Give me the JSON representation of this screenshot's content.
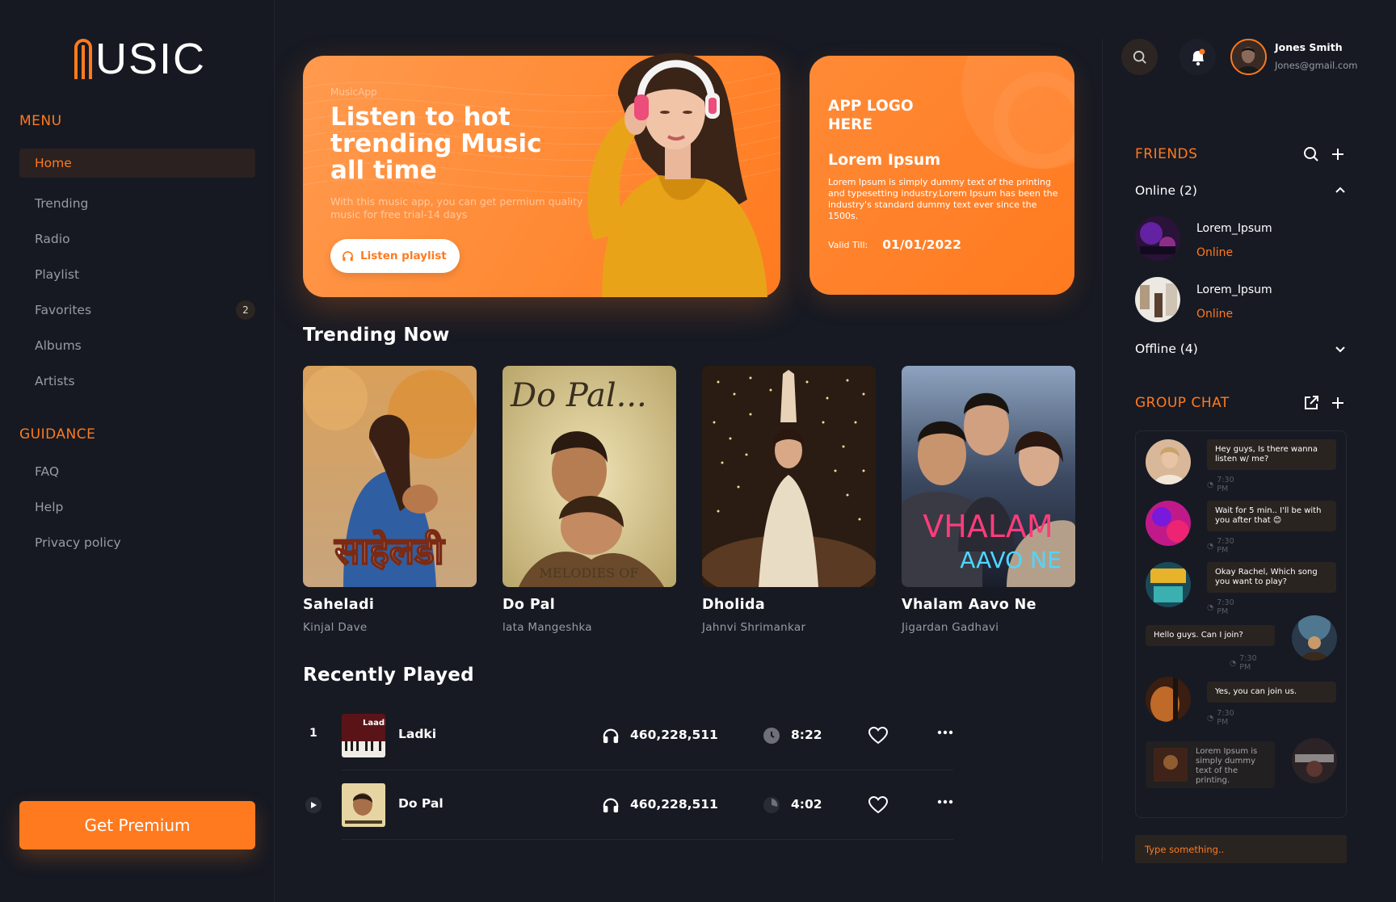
{
  "app": {
    "logo": "USIC"
  },
  "sidebar": {
    "menu_title": "MENU",
    "menu": [
      {
        "label": "Home",
        "active": true
      },
      {
        "label": "Trending"
      },
      {
        "label": "Radio"
      },
      {
        "label": "Playlist"
      },
      {
        "label": "Favorites",
        "badge": "2"
      },
      {
        "label": "Albums"
      },
      {
        "label": "Artists"
      }
    ],
    "guidance_title": "GUIDANCE",
    "guidance": [
      {
        "label": "FAQ"
      },
      {
        "label": "Help"
      },
      {
        "label": "Privacy policy"
      }
    ],
    "premium_button": "Get Premium"
  },
  "hero": {
    "eyebrow": "MusicApp",
    "title": "Listen to hot trending Music all time",
    "description": "With this music app, you can get permium quality music for free trial-14 days",
    "button": "Listen playlist"
  },
  "promo": {
    "logo": "APP LOGO HERE",
    "title": "Lorem Ipsum",
    "text": "Lorem Ipsum is simply dummy text of the printing and typesetting industry.Lorem Ipsum has been the industry's standard dummy text ever since the 1500s.",
    "valid_label": "Valid Till:",
    "valid_date": "01/01/2022"
  },
  "trending": {
    "title": "Trending Now",
    "items": [
      {
        "title": "Saheladi",
        "artist": "Kinjal Dave"
      },
      {
        "title": "Do Pal",
        "artist": "lata Mangeshka"
      },
      {
        "title": "Dholida",
        "artist": "Jahnvi Shrimankar"
      },
      {
        "title": "Vhalam Aavo Ne",
        "artist": "Jigardan Gadhavi"
      }
    ]
  },
  "recent": {
    "title": "Recently Played",
    "rows": [
      {
        "index": "1",
        "name": "Ladki",
        "plays": "460,228,511",
        "duration": "8:22"
      },
      {
        "index": "",
        "name": "Do Pal",
        "plays": "460,228,511",
        "duration": "4:02"
      }
    ]
  },
  "user": {
    "name": "Jones Smith",
    "email": "Jones@gmail.com"
  },
  "friends": {
    "title": "FRIENDS",
    "online_label": "Online (2)",
    "offline_label": "Offline (4)",
    "online": [
      {
        "name": "Lorem_Ipsum",
        "status": "Online"
      },
      {
        "name": "Lorem_Ipsum",
        "status": "Online"
      }
    ]
  },
  "group_chat": {
    "title": "GROUP CHAT",
    "messages": [
      {
        "text": "Hey guys, Is there wanna listen w/ me?",
        "time": "7:30 PM",
        "side": "left"
      },
      {
        "text": "Wait for 5 min.. I'll be with you after that 😊",
        "time": "7:30 PM",
        "side": "left"
      },
      {
        "text": "Okay Rachel, Which song you want to play?",
        "time": "7:30 PM",
        "side": "left"
      },
      {
        "text": "Hello guys. Can I join?",
        "time": "7:30 PM",
        "side": "right"
      },
      {
        "text": "Yes, you can join us.",
        "time": "7:30 PM",
        "side": "left"
      },
      {
        "text": "Lorem Ipsum is simply dummy text of the printing.",
        "time": "",
        "side": "right"
      }
    ],
    "placeholder": "Type something.."
  },
  "colors": {
    "accent": "#ff7a1f",
    "background": "#171a23",
    "bubble": "#2a2421"
  }
}
